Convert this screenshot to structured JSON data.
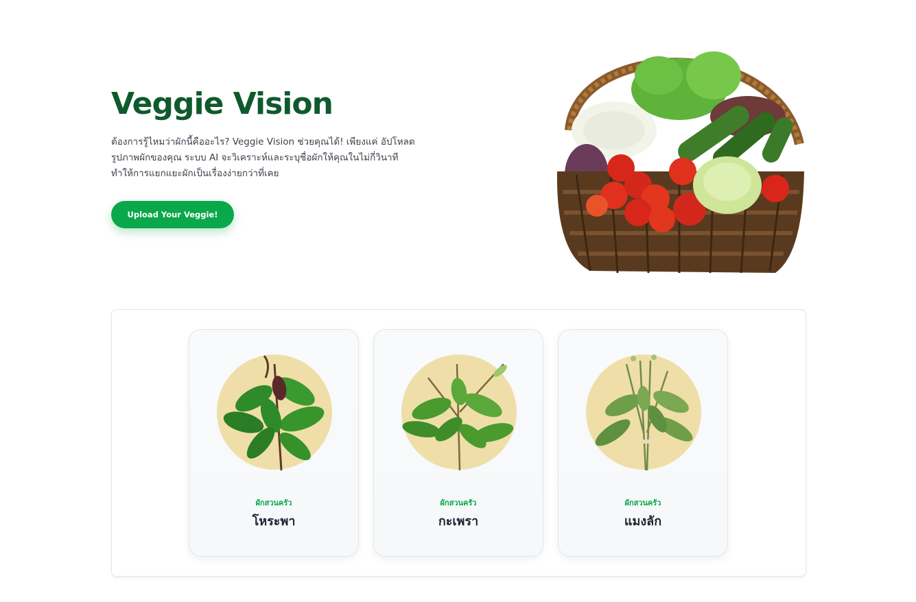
{
  "hero": {
    "title": "Veggie Vision",
    "description_lines": [
      "ต้องการรู้ไหมว่าผักนี้คืออะไร? Veggie Vision ช่วยคุณได้! เพียงแค่ อัปโหลด",
      "รูปภาพผักของคุณ ระบบ AI จะวิเคราะห์และระบุชื่อผักให้คุณในไม่กี่วินาที",
      "ทำให้การแยกแยะผักเป็นเรื่องง่ายกว่าที่เคย"
    ],
    "upload_button_label": "Upload Your Veggie!",
    "image_icon": "vegetable-basket-image"
  },
  "vegetables": [
    {
      "category": "ผักสวนครัว",
      "name": "โหระพา",
      "image_icon": "sweet-basil-image"
    },
    {
      "category": "ผักสวนครัว",
      "name": "กะเพรา",
      "image_icon": "holy-basil-image"
    },
    {
      "category": "ผักสวนครัว",
      "name": "แมงลัก",
      "image_icon": "lemon-basil-image"
    }
  ],
  "colors": {
    "brand_dark_green": "#0f5a2c",
    "accent_green": "#0aa84a",
    "card_circle": "#efdea8"
  }
}
